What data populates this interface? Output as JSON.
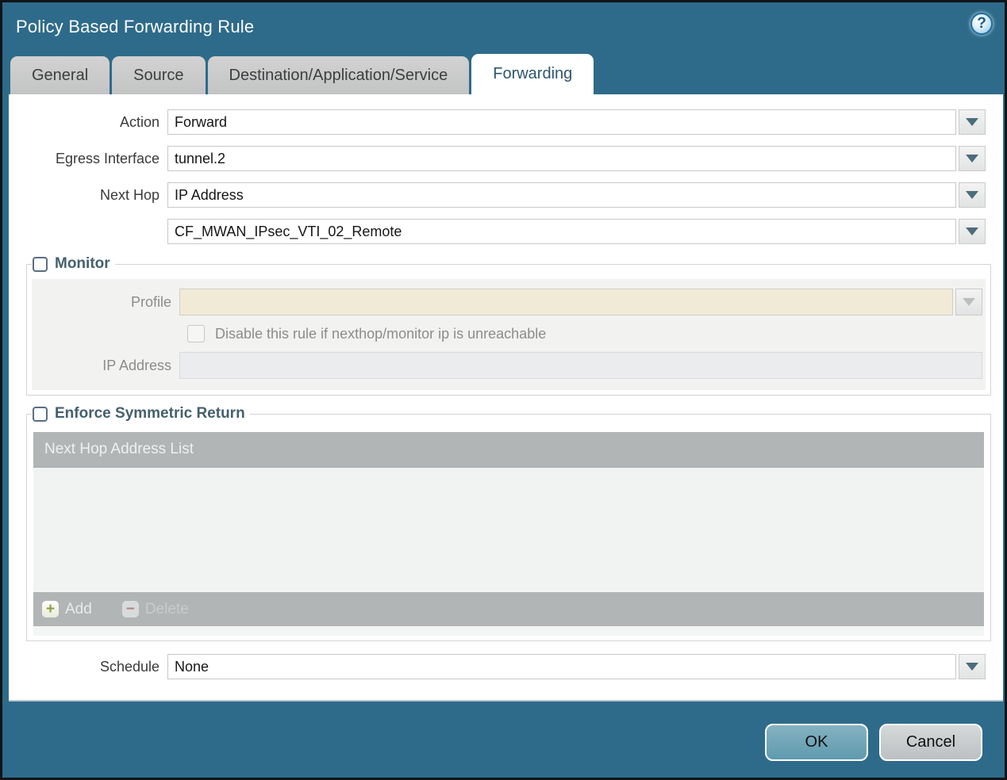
{
  "window": {
    "title": "Policy Based Forwarding Rule",
    "ok_label": "OK",
    "cancel_label": "Cancel"
  },
  "icons": {
    "help_glyph": "?",
    "add_glyph": "+",
    "delete_glyph": "−"
  },
  "tabs": [
    {
      "label": "General",
      "active": false
    },
    {
      "label": "Source",
      "active": false
    },
    {
      "label": "Destination/Application/Service",
      "active": false
    },
    {
      "label": "Forwarding",
      "active": true
    }
  ],
  "form": {
    "action_label": "Action",
    "action_value": "Forward",
    "egress_label": "Egress Interface",
    "egress_value": "tunnel.2",
    "next_hop_label": "Next Hop",
    "next_hop_value": "IP Address",
    "next_hop_address_value": "CF_MWAN_IPsec_VTI_02_Remote",
    "schedule_label": "Schedule",
    "schedule_value": "None"
  },
  "monitor": {
    "legend": "Monitor",
    "checked": false,
    "profile_label": "Profile",
    "profile_value": "",
    "disable_checkbox_label": "Disable this rule if nexthop/monitor ip is unreachable",
    "disable_checked": false,
    "ip_address_label": "IP Address",
    "ip_address_value": ""
  },
  "symmetric_return": {
    "legend": "Enforce Symmetric Return",
    "checked": false,
    "table_header": "Next Hop Address List",
    "rows": [],
    "add_label": "Add",
    "delete_label": "Delete"
  },
  "colors": {
    "titlebar_teal": "#2e6b8a",
    "active_tab_text": "#2d566b",
    "disabled_field_beige": "#f0ead7",
    "table_header_gray": "#b1b5b6",
    "ok_button": "#6ba3b6",
    "cancel_button": "#c9cccd"
  }
}
